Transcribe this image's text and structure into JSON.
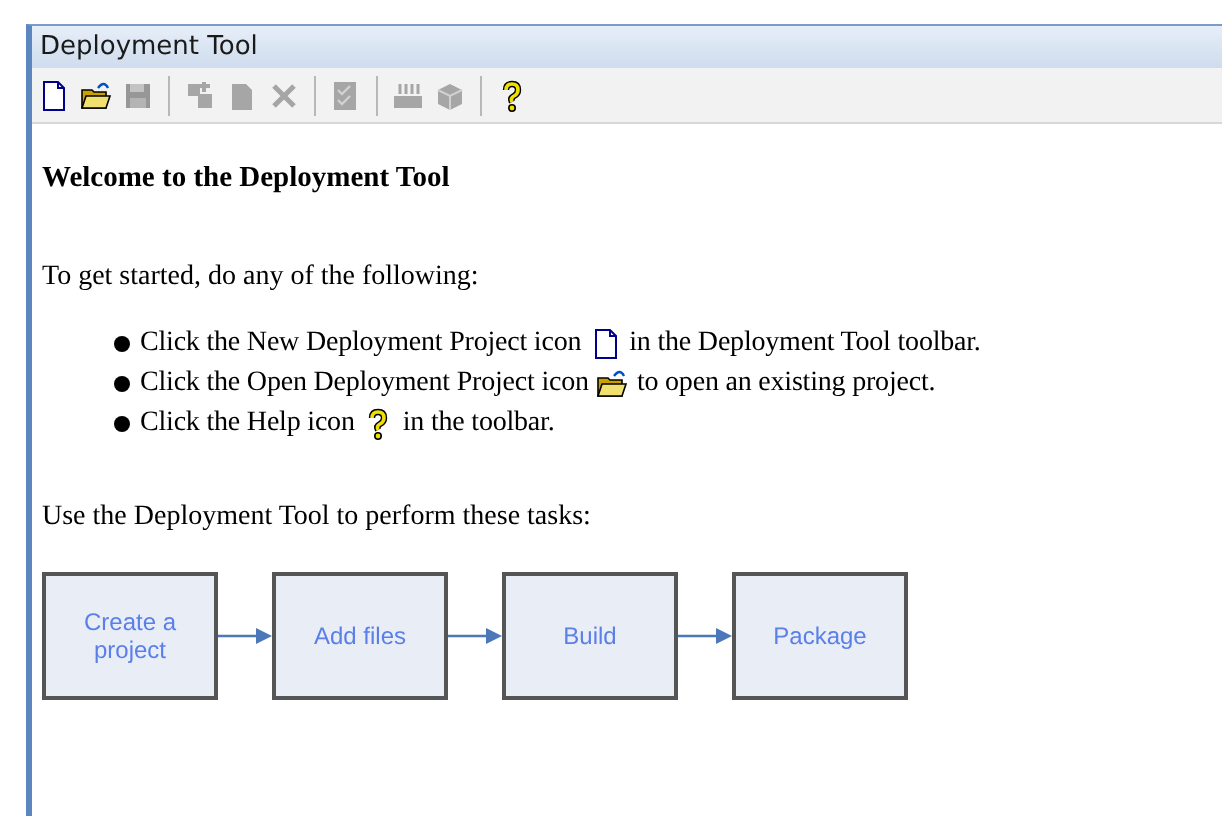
{
  "window": {
    "title": "Deployment Tool"
  },
  "toolbar": [
    {
      "kind": "new",
      "disabled": false
    },
    {
      "kind": "open",
      "disabled": false
    },
    {
      "kind": "save",
      "disabled": true
    },
    {
      "kind": "separator"
    },
    {
      "kind": "add",
      "disabled": true
    },
    {
      "kind": "page",
      "disabled": true
    },
    {
      "kind": "delete",
      "disabled": true
    },
    {
      "kind": "separator"
    },
    {
      "kind": "checklist",
      "disabled": true
    },
    {
      "kind": "separator"
    },
    {
      "kind": "build",
      "disabled": true
    },
    {
      "kind": "package",
      "disabled": true
    },
    {
      "kind": "separator"
    },
    {
      "kind": "help",
      "disabled": false
    }
  ],
  "heading": "Welcome to the Deployment Tool",
  "intro": "To get started, do any of the following:",
  "bullets": [
    {
      "before": "Click the New Deployment Project icon",
      "kind": "new",
      "after": "in the Deployment Tool toolbar."
    },
    {
      "before": "Click the Open Deployment Project icon",
      "kind": "open",
      "after": "to open an existing project."
    },
    {
      "before": "Click the Help icon",
      "kind": "help",
      "after": "in the toolbar."
    }
  ],
  "tasks_intro": "Use the Deployment Tool to perform these tasks:",
  "steps": [
    "Create a project",
    "Add files",
    "Build",
    "Package"
  ]
}
